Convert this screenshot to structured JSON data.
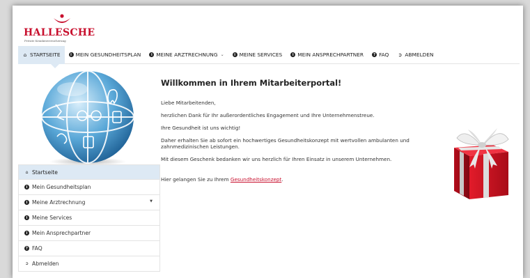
{
  "brand": {
    "name": "HALLESCHE",
    "tagline": "Private Krankenversicherung",
    "color": "#c8102e"
  },
  "topnav": {
    "items": [
      {
        "label": "STARTSEITE",
        "icon": "home-icon"
      },
      {
        "label": "MEIN GESUNDHEITSPLAN",
        "icon": "info-icon"
      },
      {
        "label": "MEINE ARZTRECHNUNG",
        "icon": "info-icon"
      },
      {
        "label": "MEINE SERVICES",
        "icon": "info-icon"
      },
      {
        "label": "MEIN ANSPRECHPARTNER",
        "icon": "info-icon"
      },
      {
        "label": "FAQ",
        "icon": "question-icon"
      },
      {
        "label": "ABMELDEN",
        "icon": "logout-icon"
      }
    ]
  },
  "sidebar": {
    "items": [
      {
        "label": "Startseite",
        "icon": "home-icon"
      },
      {
        "label": "Mein Gesundheitsplan",
        "icon": "info-icon"
      },
      {
        "label": "Meine Arztrechnung",
        "icon": "info-icon"
      },
      {
        "label": "Meine Services",
        "icon": "info-icon"
      },
      {
        "label": "Mein Ansprechpartner",
        "icon": "info-icon"
      },
      {
        "label": "FAQ",
        "icon": "question-icon"
      },
      {
        "label": "Abmelden",
        "icon": "logout-icon"
      }
    ]
  },
  "main": {
    "title": "Willkommen in Ihrem Mitarbeiterportal!",
    "paragraphs": [
      "Liebe Mitarbeitenden,",
      "herzlichen Dank für Ihr außerordentliches Engagement und Ihre Unternehmenstreue.",
      "Ihre Gesundheit ist uns wichtig!",
      "Daher erhalten Sie ab sofort ein hochwertiges Gesundheitskonzept mit wertvollen ambulanten und zahnmedizinischen Leistungen.",
      "Mit diesem Geschenk bedanken wir uns herzlich für Ihren Einsatz in unserem Unternehmen."
    ],
    "link_prefix": "Hier gelangen Sie zu Ihrem ",
    "link_text": "Gesundheitskonzept",
    "link_suffix": "."
  },
  "colors": {
    "active_bg": "#dde9f4",
    "link": "#c8102e"
  }
}
